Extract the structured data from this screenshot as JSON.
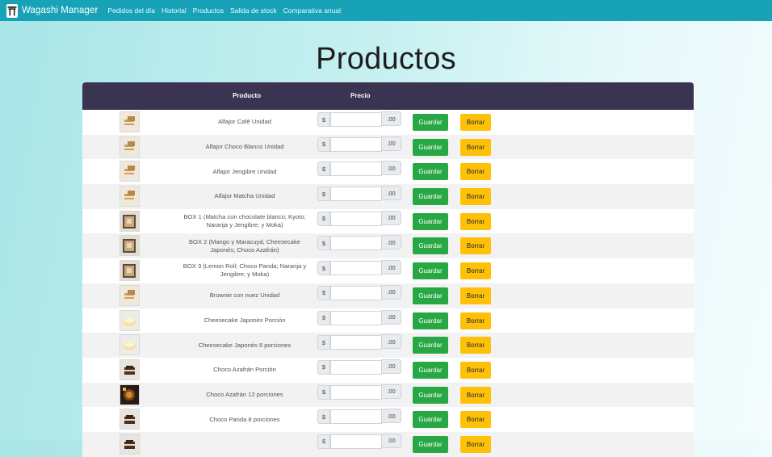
{
  "navbar": {
    "brand": "Wagashi Manager",
    "brand_icon": "torii-gate-icon",
    "links": [
      "Pedidos del día",
      "Historial",
      "Productos",
      "Salida de stock",
      "Comparativa anual"
    ]
  },
  "page": {
    "title": "Productos"
  },
  "table": {
    "headers": {
      "product": "Producto",
      "price": "Precio"
    },
    "currency_prefix": "$",
    "decimal_suffix": ".00",
    "save_label": "Guardar",
    "delete_label": "Borrar",
    "rows": [
      {
        "name": "Alfajor Café Unidad",
        "thumb": "light"
      },
      {
        "name": "Alfajor Choco Blanco Unidad",
        "thumb": "light"
      },
      {
        "name": "Alfajor Jengibre Unidad",
        "thumb": "light"
      },
      {
        "name": "Alfajor Matcha Unidad",
        "thumb": "light"
      },
      {
        "name": "BOX 1 (Matcha con chocolate blanco; Kyoto; Naranja y Jengibre; y Moka)",
        "thumb": "box"
      },
      {
        "name": "BOX 2 (Mango y Maracuyá; Cheesecake Japonés; Choco Azafrán)",
        "thumb": "box"
      },
      {
        "name": "BOX 3 (Lemon Roll; Choco Panda; Naranja y Jengibre; y Moka)",
        "thumb": "box"
      },
      {
        "name": "Brownie con nuez Unidad",
        "thumb": "light"
      },
      {
        "name": "Cheesecake Japonés Porción",
        "thumb": "cake"
      },
      {
        "name": "Cheesecake Japonés 8 porciones",
        "thumb": "cake"
      },
      {
        "name": "Choco Azafrán Porción",
        "thumb": "choco"
      },
      {
        "name": "Choco Azafrán 12 porciones",
        "thumb": "dark"
      },
      {
        "name": "Choco Panda 8 porciones",
        "thumb": "choco"
      },
      {
        "name": "",
        "thumb": "choco"
      }
    ]
  },
  "colors": {
    "navbar": "#17a2b8",
    "table_header": "#3a3351",
    "save_button": "#28a745",
    "delete_button": "#ffc107"
  }
}
